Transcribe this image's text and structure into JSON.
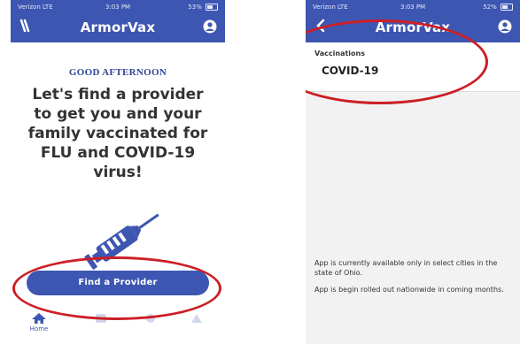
{
  "left_screen": {
    "status": {
      "carrier": "Verizon LTE",
      "time": "3:03 PM",
      "battery": "53%"
    },
    "app_title": "ArmorVax",
    "greeting": "GOOD AFTERNOON",
    "headline": "Let's find a provider to get you and your family vaccinated for FLU and COVID-19 virus!",
    "cta_label": "Find a Provider",
    "nav": [
      {
        "label": "Home",
        "icon": "home-icon"
      },
      {
        "label": "",
        "icon": "tab-icon"
      },
      {
        "label": "",
        "icon": "tab-icon"
      },
      {
        "label": "",
        "icon": "tab-icon"
      }
    ]
  },
  "right_screen": {
    "status": {
      "carrier": "Verizon LTE",
      "time": "3:03 PM",
      "battery": "52%"
    },
    "app_title": "ArmorVax",
    "section_label": "Vaccinations",
    "vaccine": "COVID-19",
    "notice_1": "App is currently available only in select cities in the state of Ohio.",
    "notice_2": "App is begin rolled out nationwide in coming months."
  },
  "colors": {
    "brand": "#3d56b2",
    "annotation": "#cc1f26"
  }
}
